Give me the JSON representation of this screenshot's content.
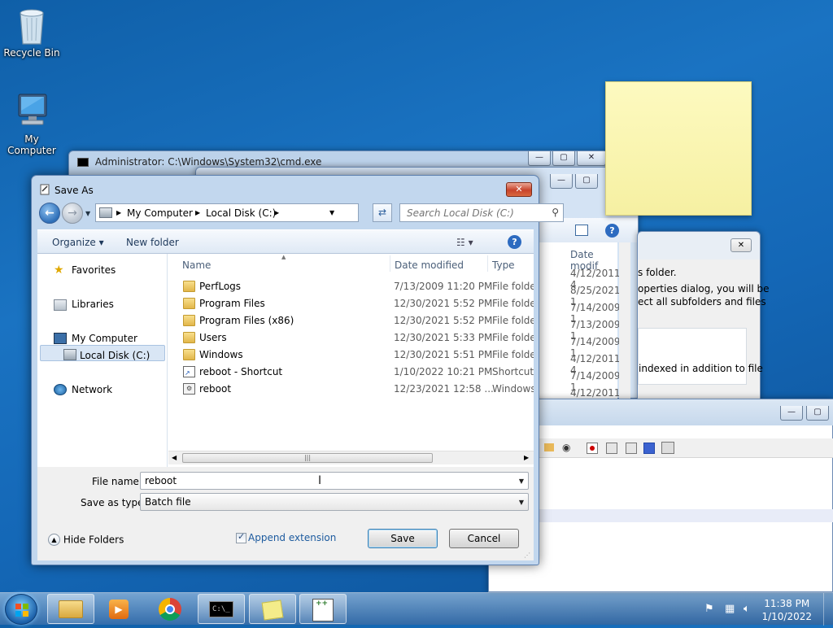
{
  "desktop": {
    "icons": [
      {
        "label": "Recycle Bin",
        "icon": "recycle-bin-icon"
      },
      {
        "label": "My Computer",
        "icon": "computer-icon"
      }
    ]
  },
  "background_windows": {
    "cmd_title": "Administrator: C:\\Windows\\System32\\cmd.exe",
    "properties_text": {
      "line1": "s folder.",
      "line2": "operties dialog, you will be",
      "line3": "ect all subfolders and files",
      "line4": "indexed in addition to file"
    },
    "explorer_column_header": "Date modif",
    "explorer_dates": [
      "4/12/2011 4",
      "8/25/2021 1",
      "7/14/2009 1",
      "7/13/2009 1",
      "7/14/2009 1",
      "4/12/2011 4",
      "7/14/2009 1",
      "4/12/2011 4"
    ]
  },
  "dialog": {
    "title": "Save As",
    "close_label": "✕",
    "address": {
      "segments": [
        "My Computer",
        "Local Disk (C:)"
      ],
      "separator": "▶"
    },
    "search_placeholder": "Search Local Disk (C:)",
    "toolbar": {
      "organize": "Organize ▾",
      "new_folder": "New folder"
    },
    "nav_pane": {
      "favorites": "Favorites",
      "libraries": "Libraries",
      "my_computer": "My Computer",
      "local_disk": "Local Disk (C:)",
      "network": "Network"
    },
    "columns": {
      "name": "Name",
      "date_modified": "Date modified",
      "type": "Type"
    },
    "files": [
      {
        "name": "PerfLogs",
        "date": "7/13/2009 11:20 PM",
        "type": "File folder",
        "icon": "folder-icon"
      },
      {
        "name": "Program Files",
        "date": "12/30/2021 5:52 PM",
        "type": "File folder",
        "icon": "folder-icon"
      },
      {
        "name": "Program Files (x86)",
        "date": "12/30/2021 5:52 PM",
        "type": "File folder",
        "icon": "folder-icon"
      },
      {
        "name": "Users",
        "date": "12/30/2021 5:33 PM",
        "type": "File folder",
        "icon": "folder-icon"
      },
      {
        "name": "Windows",
        "date": "12/30/2021 5:51 PM",
        "type": "File folder",
        "icon": "folder-icon"
      },
      {
        "name": "reboot - Shortcut",
        "date": "1/10/2022 10:21 PM",
        "type": "Shortcut",
        "icon": "shortcut-icon"
      },
      {
        "name": "reboot",
        "date": "12/23/2021 12:58 ...",
        "type": "Windows",
        "icon": "batch-file-icon"
      }
    ],
    "file_name_label": "File name:",
    "file_name_value": "reboot",
    "save_as_type_label": "Save as type:",
    "save_as_type_value": "Batch file",
    "hide_folders": "Hide Folders",
    "append_extension": "Append extension",
    "append_extension_checked": true,
    "save": "Save",
    "cancel": "Cancel"
  },
  "taskbar": {
    "items": [
      "windows-explorer-icon",
      "media-player-icon",
      "chrome-icon",
      "cmd-icon",
      "sticky-notes-icon",
      "notepad-plus-icon"
    ],
    "time": "11:38 PM",
    "date": "1/10/2022"
  }
}
